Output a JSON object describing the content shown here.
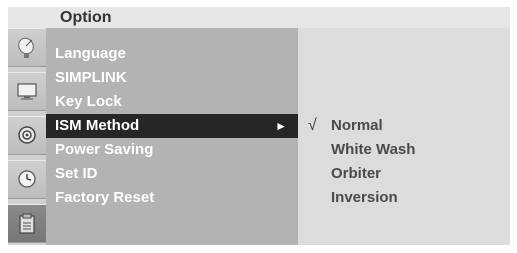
{
  "header": {
    "title": "Option"
  },
  "icons": [
    {
      "name": "satellite-dish-icon",
      "active": false
    },
    {
      "name": "monitor-icon",
      "active": false
    },
    {
      "name": "speaker-icon",
      "active": false
    },
    {
      "name": "clock-icon",
      "active": false
    },
    {
      "name": "option-settings-icon",
      "active": true
    }
  ],
  "menu": {
    "items": [
      {
        "label": "Language"
      },
      {
        "label": "SIMPLINK"
      },
      {
        "label": "Key Lock"
      },
      {
        "label": "ISM Method",
        "selected": true,
        "arrow": "►"
      },
      {
        "label": "Power Saving"
      },
      {
        "label": "Set ID"
      },
      {
        "label": "Factory Reset"
      }
    ]
  },
  "submenu": {
    "check_mark": "√",
    "items": [
      {
        "label": "Normal",
        "checked": true
      },
      {
        "label": "White Wash"
      },
      {
        "label": "Orbiter"
      },
      {
        "label": "Inversion"
      }
    ]
  },
  "colors": {
    "title_bar": "#e6e6e6",
    "menu_panel": "#b3b3b3",
    "selected_item": "#262626",
    "submenu_panel": "#dcdcdc",
    "submenu_text": "#4a4a4a"
  }
}
